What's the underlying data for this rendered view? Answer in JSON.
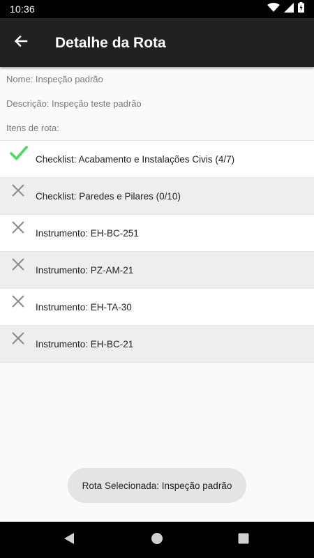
{
  "status_bar": {
    "time": "10:36",
    "icons": [
      "wifi-icon",
      "signal-icon",
      "battery-charging-icon"
    ]
  },
  "app_bar": {
    "back_icon": "arrow-back-icon",
    "title": "Detalhe da Rota"
  },
  "details": {
    "name": "Nome: Inspeção padrão",
    "description": "Descrição: Inspeção teste padrão",
    "items_header": "Itens de rota:"
  },
  "route_items": [
    {
      "status": "done",
      "icon": "check-icon",
      "label": "Checklist: Acabamento e Instalações Civis (4/7)"
    },
    {
      "status": "pending",
      "icon": "close-icon",
      "label": "Checklist: Paredes e Pilares (0/10)"
    },
    {
      "status": "pending",
      "icon": "close-icon",
      "label": "Instrumento: EH-BC-251"
    },
    {
      "status": "pending",
      "icon": "close-icon",
      "label": "Instrumento: PZ-AM-21"
    },
    {
      "status": "pending",
      "icon": "close-icon",
      "label": "Instrumento: EH-TA-30"
    },
    {
      "status": "pending",
      "icon": "close-icon",
      "label": "Instrumento: EH-BC-21"
    }
  ],
  "toast": {
    "message": "Rota Selecionada: Inspeção padrão"
  },
  "nav_bar": {
    "buttons": [
      "back-triangle-icon",
      "home-circle-icon",
      "recents-square-icon"
    ]
  },
  "colors": {
    "app_bar": "#212121",
    "check": "#4cd964",
    "cross": "#8a8a8a",
    "row_alt": "#eeeeee"
  }
}
